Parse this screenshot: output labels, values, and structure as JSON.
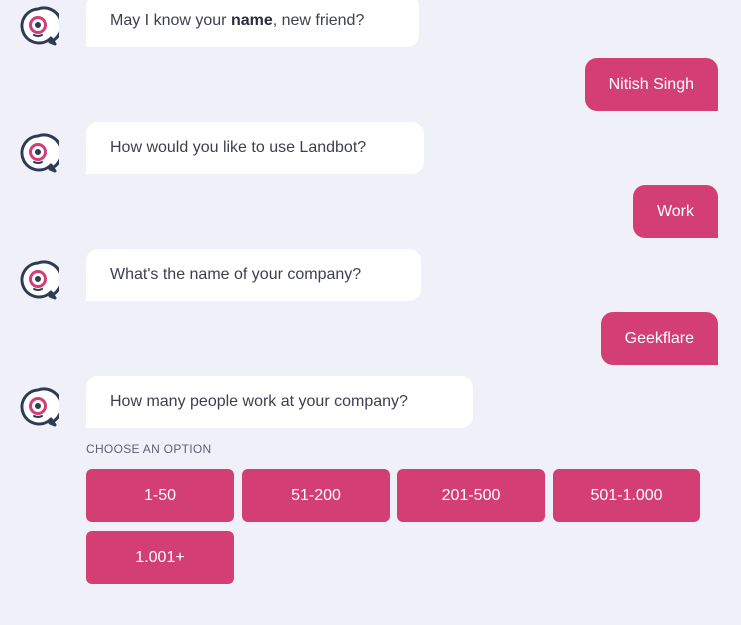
{
  "messages": {
    "bot_1": {
      "prefix": "May I know your ",
      "bold": "name",
      "suffix": ", new friend?"
    },
    "user_1": "Nitish Singh",
    "bot_2": "How would you like to use Landbot?",
    "user_2": "Work",
    "bot_3": "What's the name of your company?",
    "user_3": "Geekflare",
    "bot_4": "How many people work at your company?"
  },
  "choose_label": "CHOOSE AN OPTION",
  "options": [
    "1-50",
    "51-200",
    "201-500",
    "501-1.000",
    "1.001+"
  ],
  "colors": {
    "background": "#f0f1f8",
    "accent": "#d33f75",
    "avatar_outline": "#2f3a55",
    "bot_bubble": "#ffffff"
  },
  "icons": {
    "avatar": "landbot-avatar-icon"
  }
}
